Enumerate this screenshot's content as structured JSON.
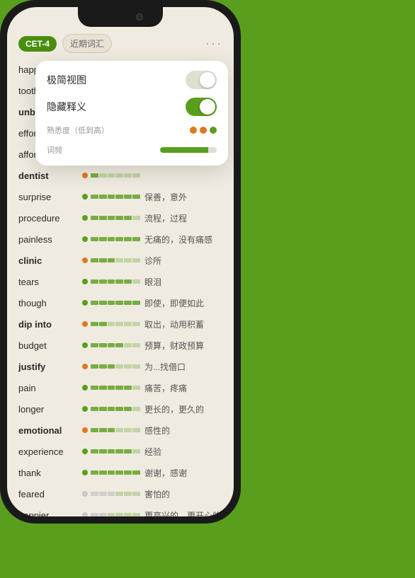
{
  "header": {
    "tag_cet4": "CET-4",
    "tag_recent": "近期词汇",
    "dots": "···"
  },
  "popup": {
    "simple_view_label": "极简视图",
    "hide_meaning_label": "隐藏释义",
    "familiarity_label": "熟悉度（低到高）",
    "frequency_label": "词频"
  },
  "words": [
    {
      "text": "happen",
      "bold": false,
      "dot": "green",
      "meaning": "",
      "visible_meaning": false
    },
    {
      "text": "toothache",
      "bold": false,
      "dot": "orange",
      "meaning": "",
      "visible_meaning": false
    },
    {
      "text": "unbearable",
      "bold": true,
      "dot": "orange",
      "meaning": "",
      "visible_meaning": false
    },
    {
      "text": "effort",
      "bold": false,
      "dot": "green",
      "meaning": "",
      "visible_meaning": false
    },
    {
      "text": "affordable",
      "bold": false,
      "dot": "green",
      "meaning": "",
      "visible_meaning": false
    },
    {
      "text": "dentist",
      "bold": true,
      "dot": "orange",
      "meaning": "",
      "visible_meaning": false
    },
    {
      "text": "surprise",
      "bold": false,
      "dot": "green",
      "meaning": "保善，意外",
      "visible_meaning": true
    },
    {
      "text": "procedure",
      "bold": false,
      "dot": "green",
      "meaning": "流程，过程",
      "visible_meaning": true
    },
    {
      "text": "painless",
      "bold": false,
      "dot": "green",
      "meaning": "无痛的，没有痛感",
      "visible_meaning": true
    },
    {
      "text": "clinic",
      "bold": true,
      "dot": "orange",
      "meaning": "诊所",
      "visible_meaning": true
    },
    {
      "text": "tears",
      "bold": false,
      "dot": "green",
      "meaning": "眼泪",
      "visible_meaning": true
    },
    {
      "text": "though",
      "bold": false,
      "dot": "green",
      "meaning": "即使，即便如此",
      "visible_meaning": true
    },
    {
      "text": "dip into",
      "bold": true,
      "dot": "orange",
      "meaning": "取出，动用积蓄",
      "visible_meaning": true
    },
    {
      "text": "budget",
      "bold": false,
      "dot": "green",
      "meaning": "预算，财政预算",
      "visible_meaning": true
    },
    {
      "text": "justify",
      "bold": true,
      "dot": "orange",
      "meaning": "为...找借口",
      "visible_meaning": true
    },
    {
      "text": "pain",
      "bold": false,
      "dot": "green",
      "meaning": "痛苦，疼痛",
      "visible_meaning": true
    },
    {
      "text": "longer",
      "bold": false,
      "dot": "green",
      "meaning": "更长的，更久的",
      "visible_meaning": true
    },
    {
      "text": "emotional",
      "bold": true,
      "dot": "orange",
      "meaning": "感性的",
      "visible_meaning": true
    },
    {
      "text": "experience",
      "bold": false,
      "dot": "green",
      "meaning": "经验",
      "visible_meaning": true
    },
    {
      "text": "thank",
      "bold": false,
      "dot": "green",
      "meaning": "谢谢，感谢",
      "visible_meaning": true
    },
    {
      "text": "feared",
      "bold": false,
      "dot": "gray",
      "meaning": "害怕的",
      "visible_meaning": true
    },
    {
      "text": "happier",
      "bold": false,
      "dot": "gray",
      "meaning": "更高兴的，更开心的",
      "visible_meaning": true
    }
  ]
}
